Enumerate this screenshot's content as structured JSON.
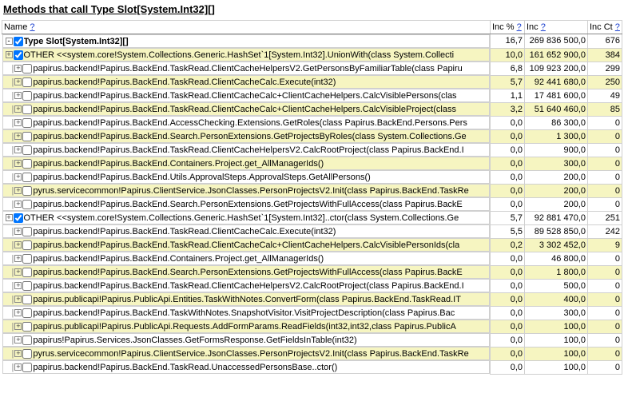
{
  "title": "Methods that call Type Slot[System.Int32][]",
  "columns": {
    "name": "Name",
    "incp": "Inc %",
    "inc": "Inc",
    "ct": "Inc Ct",
    "help": "?"
  },
  "rows": [
    {
      "depth": 0,
      "exp": "-",
      "ck": true,
      "hi": false,
      "bold": true,
      "name": "Type Slot[System.Int32][]",
      "incp": "16,7",
      "inc": "269 836 500,0",
      "ct": "676"
    },
    {
      "depth": 0,
      "exp": "+",
      "ck": true,
      "hi": true,
      "name": "OTHER <<system.core!System.Collections.Generic.HashSet`1[System.Int32].UnionWith(class System.Collecti",
      "incp": "10,0",
      "inc": "161 652 900,0",
      "ct": "384"
    },
    {
      "depth": 1,
      "exp": "+",
      "ck": false,
      "hi": false,
      "name": "papirus.backend!Papirus.BackEnd.TaskRead.ClientCacheHelpersV2.GetPersonsByFamiliarTable(class Papiru",
      "incp": "6,8",
      "inc": "109 923 200,0",
      "ct": "299"
    },
    {
      "depth": 1,
      "exp": "+",
      "ck": false,
      "hi": true,
      "name": "papirus.backend!Papirus.BackEnd.TaskRead.ClientCacheCalc.Execute(int32)",
      "incp": "5,7",
      "inc": "92 441 680,0",
      "ct": "250"
    },
    {
      "depth": 1,
      "exp": "+",
      "ck": false,
      "hi": false,
      "name": "papirus.backend!Papirus.BackEnd.TaskRead.ClientCacheCalc+ClientCacheHelpers.CalcVisiblePersons(clas",
      "incp": "1,1",
      "inc": "17 481 600,0",
      "ct": "49"
    },
    {
      "depth": 1,
      "exp": "+",
      "ck": false,
      "hi": true,
      "name": "papirus.backend!Papirus.BackEnd.TaskRead.ClientCacheCalc+ClientCacheHelpers.CalcVisibleProject(class",
      "incp": "3,2",
      "inc": "51 640 460,0",
      "ct": "85"
    },
    {
      "depth": 1,
      "exp": "+",
      "ck": false,
      "hi": false,
      "name": "papirus.backend!Papirus.BackEnd.AccessChecking.Extensions.GetRoles(class Papirus.BackEnd.Persons.Pers",
      "incp": "0,0",
      "inc": "86 300,0",
      "ct": "0"
    },
    {
      "depth": 1,
      "exp": "+",
      "ck": false,
      "hi": true,
      "name": "papirus.backend!Papirus.BackEnd.Search.PersonExtensions.GetProjectsByRoles(class System.Collections.Ge",
      "incp": "0,0",
      "inc": "1 300,0",
      "ct": "0"
    },
    {
      "depth": 1,
      "exp": "+",
      "ck": false,
      "hi": false,
      "name": "papirus.backend!Papirus.BackEnd.TaskRead.ClientCacheHelpersV2.CalcRootProject(class Papirus.BackEnd.I",
      "incp": "0,0",
      "inc": "900,0",
      "ct": "0"
    },
    {
      "depth": 1,
      "exp": "+",
      "ck": false,
      "hi": true,
      "name": "papirus.backend!Papirus.BackEnd.Containers.Project.get_AllManagerIds()",
      "incp": "0,0",
      "inc": "300,0",
      "ct": "0"
    },
    {
      "depth": 1,
      "exp": "+",
      "ck": false,
      "hi": false,
      "name": "papirus.backend!Papirus.BackEnd.Utils.ApprovalSteps.ApprovalSteps.GetAllPersons()",
      "incp": "0,0",
      "inc": "200,0",
      "ct": "0"
    },
    {
      "depth": 1,
      "exp": "+",
      "ck": false,
      "hi": true,
      "name": "pyrus.servicecommon!Papirus.ClientService.JsonClasses.PersonProjectsV2.Init(class Papirus.BackEnd.TaskRe",
      "incp": "0,0",
      "inc": "200,0",
      "ct": "0"
    },
    {
      "depth": 1,
      "exp": "+",
      "ck": false,
      "hi": false,
      "name": "papirus.backend!Papirus.BackEnd.Search.PersonExtensions.GetProjectsWithFullAccess(class Papirus.BackE",
      "incp": "0,0",
      "inc": "200,0",
      "ct": "0"
    },
    {
      "depth": 0,
      "exp": "+",
      "ck": true,
      "hi": false,
      "name": "OTHER <<system.core!System.Collections.Generic.HashSet`1[System.Int32]..ctor(class System.Collections.Ge",
      "incp": "5,7",
      "inc": "92 881 470,0",
      "ct": "251"
    },
    {
      "depth": 1,
      "exp": "+",
      "ck": false,
      "hi": false,
      "name": "papirus.backend!Papirus.BackEnd.TaskRead.ClientCacheCalc.Execute(int32)",
      "incp": "5,5",
      "inc": "89 528 850,0",
      "ct": "242"
    },
    {
      "depth": 1,
      "exp": "+",
      "ck": false,
      "hi": true,
      "name": "papirus.backend!Papirus.BackEnd.TaskRead.ClientCacheCalc+ClientCacheHelpers.CalcVisiblePersonIds(cla",
      "incp": "0,2",
      "inc": "3 302 452,0",
      "ct": "9"
    },
    {
      "depth": 1,
      "exp": "+",
      "ck": false,
      "hi": false,
      "name": "papirus.backend!Papirus.BackEnd.Containers.Project.get_AllManagerIds()",
      "incp": "0,0",
      "inc": "46 800,0",
      "ct": "0"
    },
    {
      "depth": 1,
      "exp": "+",
      "ck": false,
      "hi": true,
      "name": "papirus.backend!Papirus.BackEnd.Search.PersonExtensions.GetProjectsWithFullAccess(class Papirus.BackE",
      "incp": "0,0",
      "inc": "1 800,0",
      "ct": "0"
    },
    {
      "depth": 1,
      "exp": "+",
      "ck": false,
      "hi": false,
      "name": "papirus.backend!Papirus.BackEnd.TaskRead.ClientCacheHelpersV2.CalcRootProject(class Papirus.BackEnd.I",
      "incp": "0,0",
      "inc": "500,0",
      "ct": "0"
    },
    {
      "depth": 1,
      "exp": "+",
      "ck": false,
      "hi": true,
      "name": "papirus.publicapi!Papirus.PublicApi.Entities.TaskWithNotes.ConvertForm(class Papirus.BackEnd.TaskRead.IT",
      "incp": "0,0",
      "inc": "400,0",
      "ct": "0"
    },
    {
      "depth": 1,
      "exp": "+",
      "ck": false,
      "hi": false,
      "name": "papirus.backend!Papirus.BackEnd.TaskWithNotes.SnapshotVisitor.VisitProjectDescription(class Papirus.Bac",
      "incp": "0,0",
      "inc": "300,0",
      "ct": "0"
    },
    {
      "depth": 1,
      "exp": "+",
      "ck": false,
      "hi": true,
      "name": "papirus.publicapi!Papirus.PublicApi.Requests.AddFormParams.ReadFields(int32,int32,class Papirus.PublicA",
      "incp": "0,0",
      "inc": "100,0",
      "ct": "0"
    },
    {
      "depth": 1,
      "exp": "+",
      "ck": false,
      "hi": false,
      "name": "papirus!Papirus.Services.JsonClasses.GetFormsResponse.GetFieldsInTable(int32)",
      "incp": "0,0",
      "inc": "100,0",
      "ct": "0"
    },
    {
      "depth": 1,
      "exp": "+",
      "ck": false,
      "hi": true,
      "name": "pyrus.servicecommon!Papirus.ClientService.JsonClasses.PersonProjectsV2.Init(class Papirus.BackEnd.TaskRe",
      "incp": "0,0",
      "inc": "100,0",
      "ct": "0"
    },
    {
      "depth": 1,
      "exp": "+",
      "ck": false,
      "hi": false,
      "name": "papirus.backend!Papirus.BackEnd.TaskRead.UnaccessedPersonsBase..ctor()",
      "incp": "0,0",
      "inc": "100,0",
      "ct": "0"
    }
  ]
}
